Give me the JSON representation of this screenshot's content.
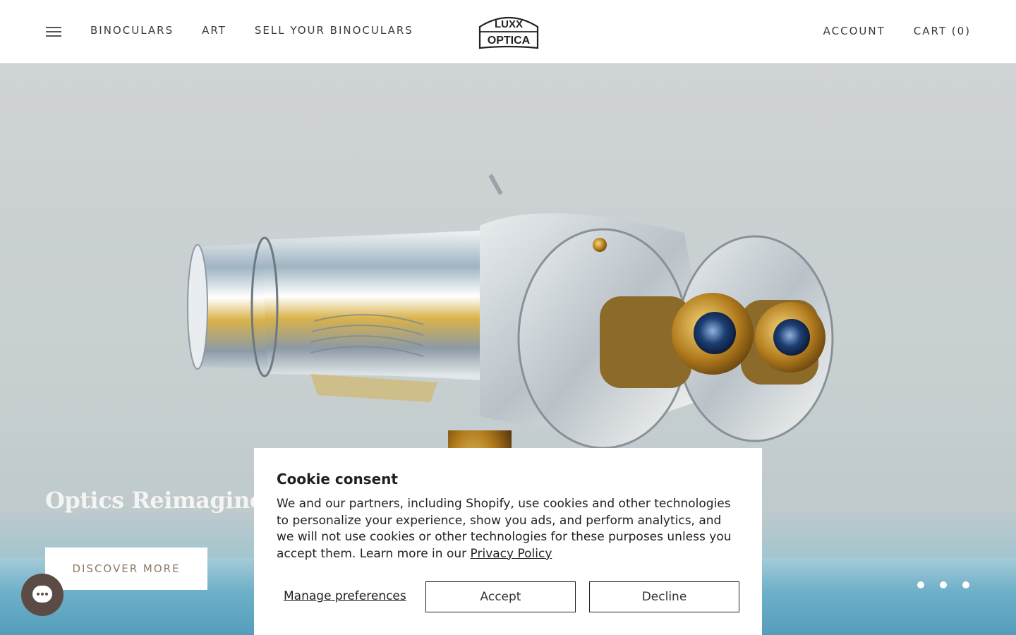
{
  "header": {
    "nav_left": [
      "BINOCULARS",
      "ART",
      "SELL YOUR BINOCULARS"
    ],
    "logo_line1": "LUXX",
    "logo_line2": "OPTICA",
    "account_label": "ACCOUNT",
    "cart_label": "CART (0)"
  },
  "hero": {
    "title": "Optics Reimagined. Hist",
    "cta_label": "DISCOVER MORE",
    "slide_dot_count": 3
  },
  "cookie_consent": {
    "title": "Cookie consent",
    "body_text": "We and our partners, including Shopify, use cookies and other technologies to personalize your experience, show you ads, and perform analytics, and we will not use cookies or other technologies for these purposes unless you accept them. Learn more in our ",
    "privacy_link": "Privacy Policy",
    "manage_label": "Manage preferences",
    "accept_label": "Accept",
    "decline_label": "Decline"
  },
  "icons": {
    "menu": "hamburger-menu-icon",
    "chat": "chat-bubble-icon"
  },
  "colors": {
    "cta_text": "#8a7a66",
    "chat_bubble": "#5c4a45",
    "header_text": "#3a3a3a"
  }
}
